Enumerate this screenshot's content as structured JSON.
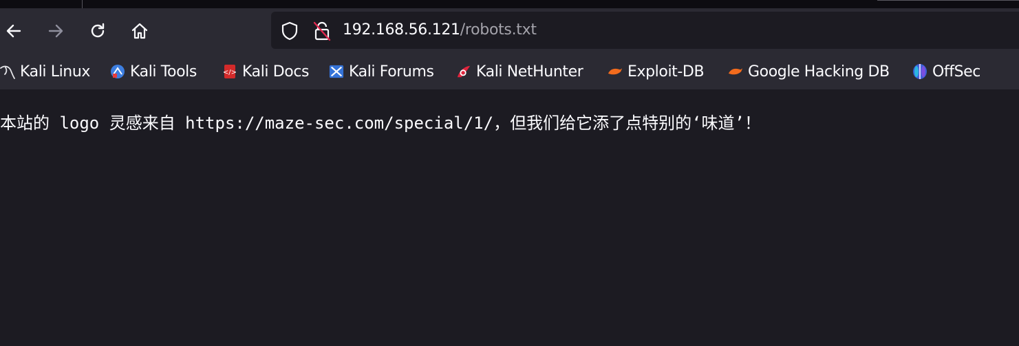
{
  "browser": {
    "url": {
      "host": "192.168.56.121",
      "path": "/robots.txt"
    },
    "nav": {
      "back_icon": "arrow-left-icon",
      "forward_icon": "arrow-right-icon",
      "reload_icon": "reload-icon",
      "home_icon": "home-icon"
    }
  },
  "bookmarks": [
    {
      "label": "Kali Linux",
      "icon": "kali-dragon-icon"
    },
    {
      "label": "Kali Tools",
      "icon": "kali-tools-icon"
    },
    {
      "label": "Kali Docs",
      "icon": "kali-docs-icon"
    },
    {
      "label": "Kali Forums",
      "icon": "kali-forums-icon"
    },
    {
      "label": "Kali NetHunter",
      "icon": "kali-nethunter-icon"
    },
    {
      "label": "Exploit-DB",
      "icon": "exploit-db-icon"
    },
    {
      "label": "Google Hacking DB",
      "icon": "ghdb-icon"
    },
    {
      "label": "OffSec",
      "icon": "offsec-icon"
    }
  ],
  "page": {
    "text": "本站的 logo 灵感来自 https://maze-sec.com/special/1/，但我们给它添了点特别的‘味道’！"
  }
}
